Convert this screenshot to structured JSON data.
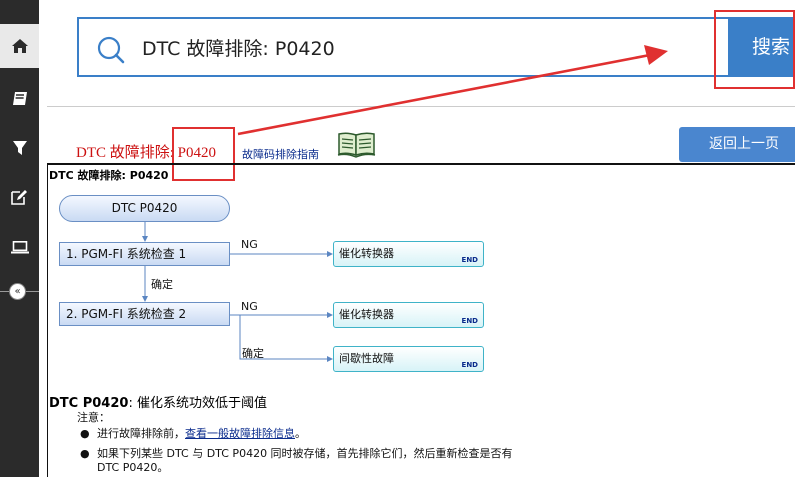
{
  "sidebar": {
    "items": [
      {
        "icon": "home-icon"
      },
      {
        "icon": "book-icon"
      },
      {
        "icon": "filter-icon"
      },
      {
        "icon": "edit-icon"
      },
      {
        "icon": "laptop-icon"
      }
    ],
    "collapse_label": "«"
  },
  "search": {
    "value": "DTC 故障排除: P0420",
    "button_label": "搜索"
  },
  "header": {
    "title": "DTC 故障排除: P0420",
    "guide_link": "故障码排除指南",
    "back_label": "返回上一页"
  },
  "content": {
    "heading": "DTC 故障排除: P0420",
    "flow": {
      "start": "DTC P0420",
      "step1": "1.  PGM-FI 系统检查 1",
      "step2": "2.  PGM-FI 系统检查 2",
      "ng_label": "NG",
      "ok_label": "确定",
      "result1": "催化转换器",
      "result2": "催化转换器",
      "result3": "间歇性故障",
      "end_label": "END"
    },
    "desc_code": "DTC P0420",
    "desc_text": ": 催化系统功效低于阈值",
    "note_label": "注意：",
    "bullets": {
      "b1_prefix": "进行故障排除前，",
      "b1_link": "查看一般故障排除信息",
      "b1_suffix": "。",
      "b2_line1": "如果下列某些 DTC 与 DTC P0420 同时被存储，首先排除它们，然后重新检查是否有",
      "b2_line2": "DTC P0420。"
    }
  },
  "colors": {
    "accent": "#3a7fc8",
    "highlight": "#e03030",
    "sidebar": "#2b2b2b",
    "title_red": "#cc1111"
  }
}
